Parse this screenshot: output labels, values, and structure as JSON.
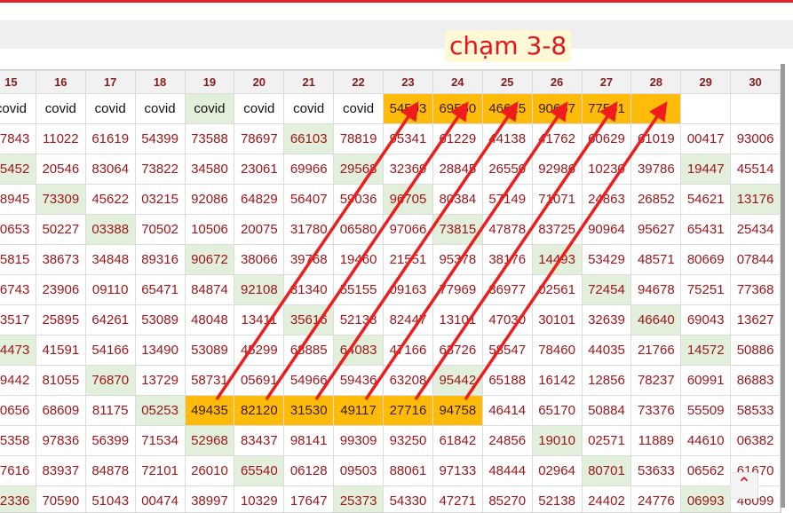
{
  "caption": "chạm 3-8",
  "table": {
    "headers": [
      "15",
      "16",
      "17",
      "18",
      "19",
      "20",
      "21",
      "22",
      "23",
      "24",
      "25",
      "26",
      "27",
      "28",
      "29",
      "30"
    ],
    "rows": [
      {
        "cells": [
          "covid",
          "covid",
          "covid",
          "covid",
          "covid",
          "covid",
          "covid",
          "covid",
          "54503",
          "69550",
          "46625",
          "90667",
          "77561",
          "",
          "",
          ""
        ]
      },
      {
        "cells": [
          "77843",
          "11022",
          "61619",
          "54399",
          "73588",
          "78697",
          "66103",
          "78819",
          "95341",
          "61229",
          "44138",
          "41762",
          "60629",
          "61019",
          "00417",
          "93006"
        ]
      },
      {
        "cells": [
          "55452",
          "20546",
          "83064",
          "73822",
          "34580",
          "23061",
          "69966",
          "29568",
          "32369",
          "28845",
          "26550",
          "92986",
          "10230",
          "39786",
          "19447",
          "45514"
        ]
      },
      {
        "cells": [
          "78945",
          "73309",
          "45622",
          "03215",
          "92086",
          "64829",
          "56407",
          "59036",
          "96705",
          "80384",
          "57149",
          "71071",
          "24863",
          "26852",
          "54621",
          "13176"
        ]
      },
      {
        "cells": [
          "70653",
          "50227",
          "03388",
          "70502",
          "10506",
          "20075",
          "31780",
          "06580",
          "97066",
          "73815",
          "47878",
          "83725",
          "90964",
          "95627",
          "65431",
          "25434"
        ]
      },
      {
        "cells": [
          "45815",
          "38673",
          "34848",
          "89316",
          "90672",
          "38066",
          "39768",
          "19460",
          "21551",
          "95378",
          "38176",
          "14493",
          "53429",
          "48571",
          "80669",
          "07844"
        ]
      },
      {
        "cells": [
          "76743",
          "23906",
          "09110",
          "65471",
          "84874",
          "92108",
          "31340",
          "55155",
          "09163",
          "77969",
          "36977",
          "02561",
          "72454",
          "94678",
          "75251",
          "77368"
        ]
      },
      {
        "cells": [
          "43517",
          "25895",
          "64261",
          "53089",
          "48048",
          "13411",
          "35616",
          "52138",
          "82447",
          "13101",
          "47030",
          "30101",
          "32639",
          "46640",
          "69043",
          "13627"
        ]
      },
      {
        "cells": [
          "44473",
          "41591",
          "54166",
          "13490",
          "53089",
          "45299",
          "68885",
          "64083",
          "47166",
          "63726",
          "58547",
          "78460",
          "44035",
          "21766",
          "14572",
          "50886"
        ]
      },
      {
        "cells": [
          "89442",
          "81055",
          "76870",
          "13729",
          "58731",
          "05691",
          "54966",
          "59436",
          "63208",
          "95442",
          "65188",
          "16142",
          "12856",
          "78237",
          "60991",
          "86883"
        ]
      },
      {
        "cells": [
          "20656",
          "68609",
          "81175",
          "05253",
          "49435",
          "82120",
          "31530",
          "49117",
          "27716",
          "94758",
          "46414",
          "65170",
          "50884",
          "73376",
          "55509",
          "58533"
        ]
      },
      {
        "cells": [
          "05358",
          "97836",
          "56399",
          "71534",
          "52968",
          "83437",
          "98141",
          "99309",
          "93250",
          "61842",
          "24856",
          "19010",
          "02571",
          "11889",
          "44610",
          "06382"
        ]
      },
      {
        "cells": [
          "17616",
          "83937",
          "84878",
          "72101",
          "26010",
          "65540",
          "06128",
          "09503",
          "88061",
          "97133",
          "48444",
          "02964",
          "80701",
          "53633",
          "06562",
          "61670"
        ]
      },
      {
        "cells": [
          "02336",
          "70590",
          "51043",
          "00474",
          "38997",
          "10329",
          "17647",
          "25373",
          "54330",
          "47271",
          "85270",
          "52138",
          "24402",
          "24776",
          "06993",
          "46099"
        ]
      }
    ]
  },
  "highlights": {
    "green": [
      [
        0,
        4
      ],
      [
        1,
        6
      ],
      [
        2,
        0
      ],
      [
        2,
        7
      ],
      [
        2,
        14
      ],
      [
        3,
        1
      ],
      [
        3,
        8
      ],
      [
        3,
        15
      ],
      [
        4,
        2
      ],
      [
        4,
        9
      ],
      [
        5,
        4
      ],
      [
        5,
        11
      ],
      [
        6,
        5
      ],
      [
        6,
        12
      ],
      [
        7,
        6
      ],
      [
        7,
        13
      ],
      [
        8,
        0
      ],
      [
        8,
        7
      ],
      [
        8,
        14
      ],
      [
        9,
        2
      ],
      [
        9,
        9
      ],
      [
        10,
        3
      ],
      [
        11,
        4
      ],
      [
        11,
        11
      ],
      [
        12,
        5
      ],
      [
        12,
        12
      ],
      [
        13,
        0
      ],
      [
        13,
        7
      ],
      [
        13,
        14
      ]
    ],
    "orange": [
      [
        0,
        8
      ],
      [
        0,
        9
      ],
      [
        0,
        10
      ],
      [
        0,
        11
      ],
      [
        0,
        12
      ],
      [
        0,
        13
      ],
      [
        10,
        4
      ],
      [
        10,
        5
      ],
      [
        10,
        6
      ],
      [
        10,
        7
      ],
      [
        10,
        8
      ],
      [
        10,
        9
      ]
    ]
  },
  "arrows": [
    {
      "from": [
        10,
        4
      ],
      "to": [
        0,
        8
      ]
    },
    {
      "from": [
        10,
        5
      ],
      "to": [
        0,
        9
      ]
    },
    {
      "from": [
        10,
        6
      ],
      "to": [
        0,
        10
      ]
    },
    {
      "from": [
        10,
        7
      ],
      "to": [
        0,
        11
      ]
    },
    {
      "from": [
        10,
        8
      ],
      "to": [
        0,
        12
      ]
    },
    {
      "from": [
        10,
        9
      ],
      "to": [
        0,
        13
      ]
    }
  ],
  "colors": {
    "arrow": "#ee1c1c",
    "orange": "#ffbb0a",
    "green": "#e1efdb",
    "number": "#a0161b"
  },
  "scroll_top_icon": "chevron-up-icon"
}
